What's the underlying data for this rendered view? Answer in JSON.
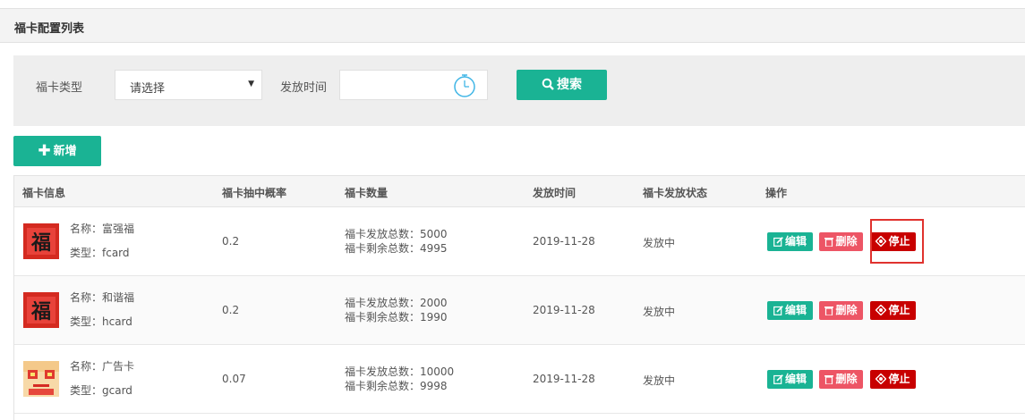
{
  "panel": {
    "title": "福卡配置列表"
  },
  "search": {
    "type_label": "福卡类型",
    "type_value": "请选择",
    "time_label": "发放时间",
    "time_value": "",
    "search_label": "搜索"
  },
  "toolbar": {
    "add_label": "新增"
  },
  "table": {
    "headers": [
      "福卡信息",
      "福卡抽中概率",
      "福卡数量",
      "发放时间",
      "福卡发放状态",
      "操作"
    ],
    "rows": [
      {
        "name": "名称：富强福",
        "type": "类型：fcard",
        "prob": "0.2",
        "total": "福卡发放总数：5000",
        "remain": "福卡剩余总数：4995",
        "date": "2019-11-28",
        "status": "发放中",
        "image": "fu-card-red",
        "glyph": "福"
      },
      {
        "name": "名称：和谐福",
        "type": "类型：hcard",
        "prob": "0.2",
        "total": "福卡发放总数：2000",
        "remain": "福卡剩余总数：1990",
        "date": "2019-11-28",
        "status": "发放中",
        "image": "fu-card-red",
        "glyph": "福"
      },
      {
        "name": "名称：广告卡",
        "type": "类型：gcard",
        "prob": "0.07",
        "total": "福卡发放总数：10000",
        "remain": "福卡剩余总数：9998",
        "date": "2019-11-28",
        "status": "发放中",
        "image": "ad-card",
        "glyph": ""
      }
    ],
    "actions": {
      "edit": "编辑",
      "delete": "删除",
      "stop": "停止"
    }
  },
  "colors": {
    "primary": "#1ab394",
    "danger": "#ed5565",
    "stop": "#c80000",
    "highlight": "#e0322e"
  }
}
